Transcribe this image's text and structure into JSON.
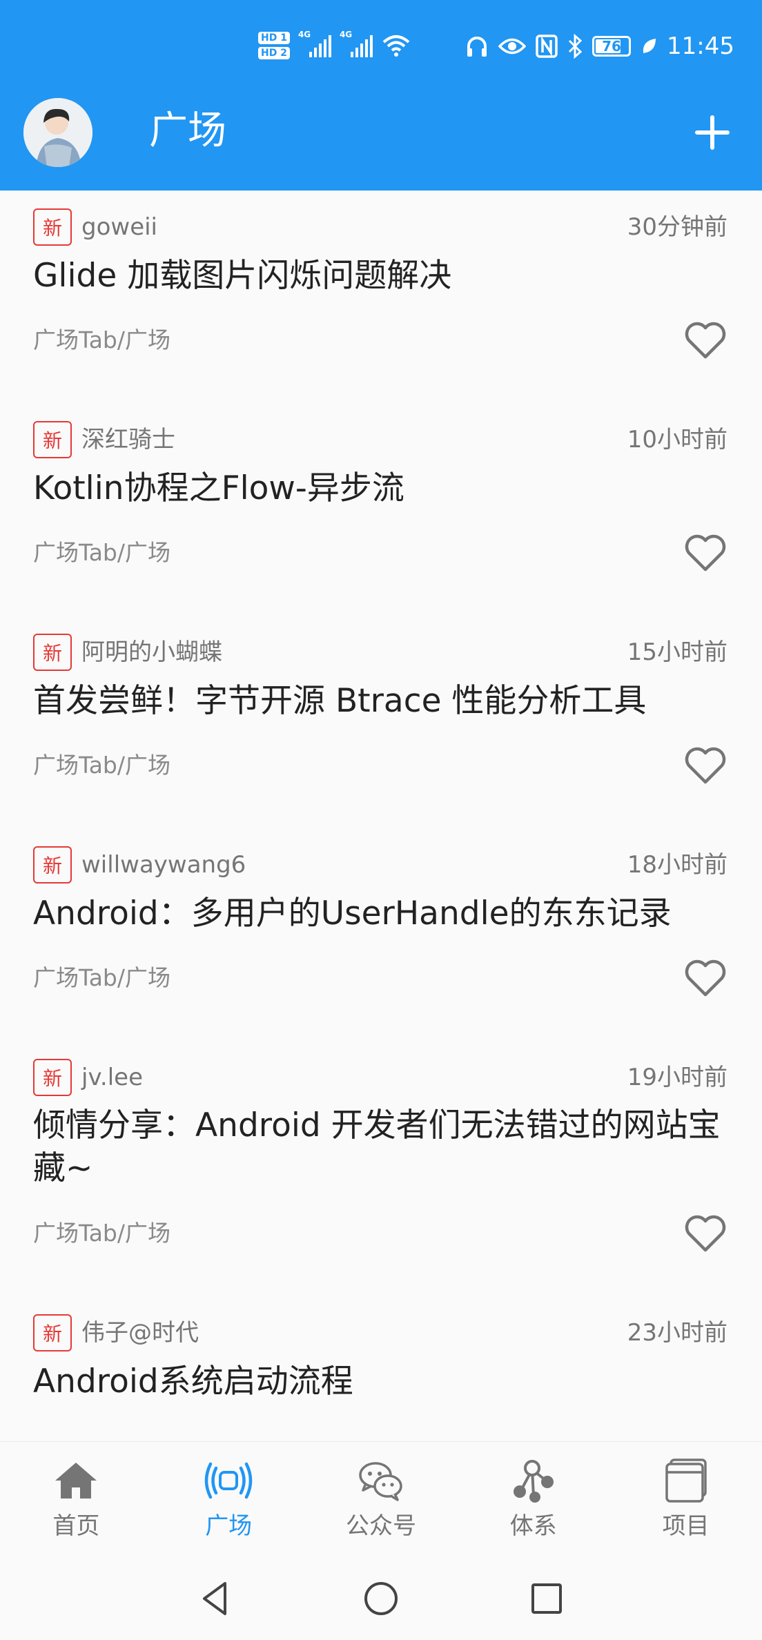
{
  "status_bar": {
    "hd1": "HD 1",
    "hd2": "HD 2",
    "net1": "4G",
    "net2": "4G",
    "battery": "76",
    "time": "11:45"
  },
  "app_bar": {
    "title": "广场",
    "accent_color": "#2196f3"
  },
  "articles": [
    {
      "tag": "新",
      "author": "goweii",
      "time": "30分钟前",
      "title": "Glide 加载图片闪烁问题解决",
      "category": "广场Tab/广场"
    },
    {
      "tag": "新",
      "author": "深红骑士",
      "time": "10小时前",
      "title": "Kotlin协程之Flow-异步流",
      "category": "广场Tab/广场"
    },
    {
      "tag": "新",
      "author": "阿明的小蝴蝶",
      "time": "15小时前",
      "title": "首发尝鲜！字节开源 Btrace 性能分析工具",
      "category": "广场Tab/广场"
    },
    {
      "tag": "新",
      "author": "willwaywang6",
      "time": "18小时前",
      "title": "Android：多用户的UserHandle的东东记录",
      "category": "广场Tab/广场"
    },
    {
      "tag": "新",
      "author": "jv.lee",
      "time": "19小时前",
      "title": "倾情分享：Android 开发者们无法错过的网站宝藏~",
      "category": "广场Tab/广场"
    },
    {
      "tag": "新",
      "author": "伟子@时代",
      "time": "23小时前",
      "title": "Android系统启动流程",
      "category": ""
    }
  ],
  "bottom_nav": [
    {
      "label": "首页",
      "icon": "home-icon",
      "active": false
    },
    {
      "label": "广场",
      "icon": "broadcast-icon",
      "active": true
    },
    {
      "label": "公众号",
      "icon": "wechat-icon",
      "active": false
    },
    {
      "label": "体系",
      "icon": "tree-icon",
      "active": false
    },
    {
      "label": "项目",
      "icon": "project-icon",
      "active": false
    }
  ],
  "colors": {
    "new_tag": "#e53935",
    "text_primary": "#222222",
    "text_secondary": "#757575"
  }
}
